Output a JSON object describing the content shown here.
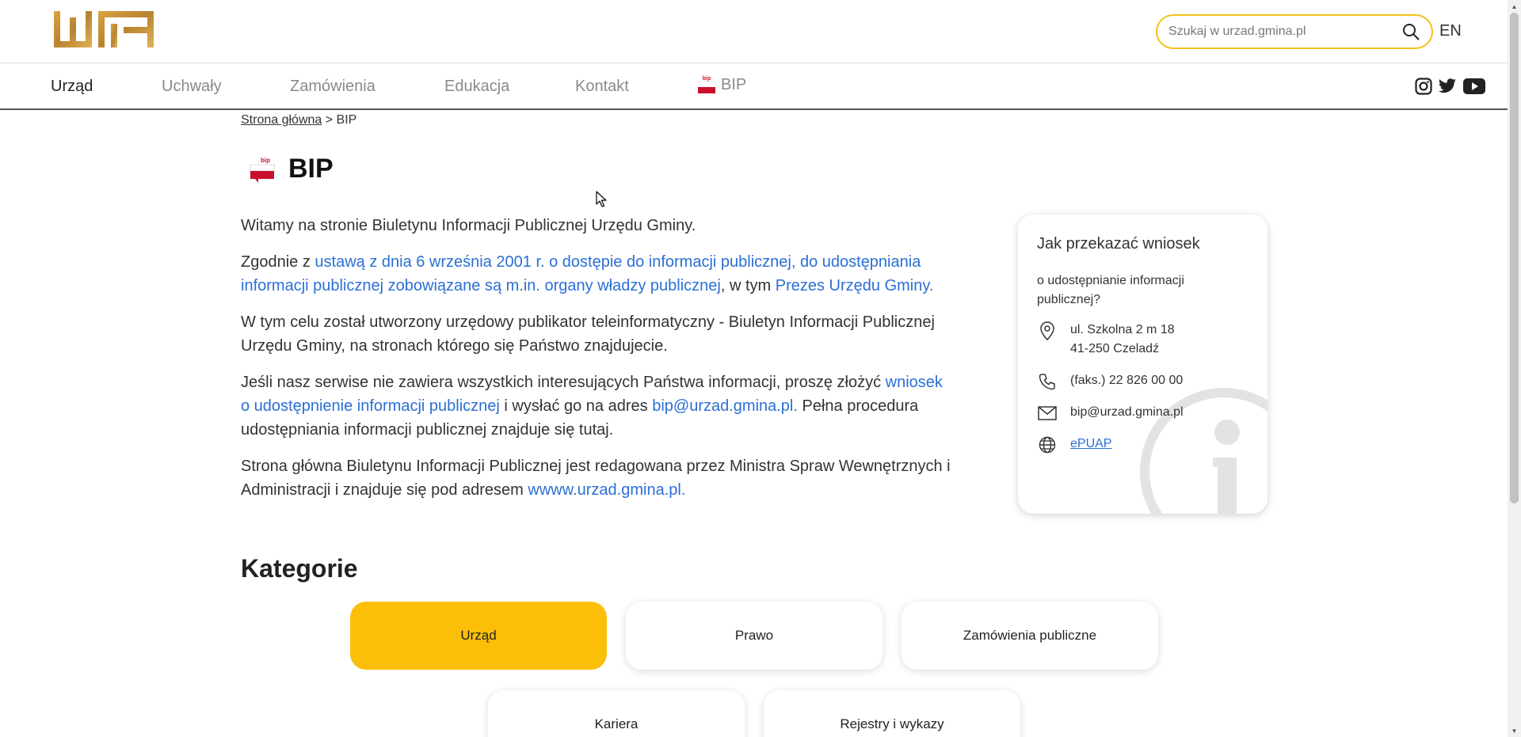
{
  "header": {
    "logo_text": "WA",
    "search": {
      "placeholder": "Szukaj w urzad.gmina.pl",
      "value": ""
    },
    "lang": "EN"
  },
  "nav": {
    "items": [
      {
        "label": "Urząd",
        "active": true
      },
      {
        "label": "Uchwały",
        "active": false
      },
      {
        "label": "Zamówienia",
        "active": false
      },
      {
        "label": "Edukacja",
        "active": false
      },
      {
        "label": "Kontakt",
        "active": false
      },
      {
        "label": "BIP",
        "active": false,
        "icon": "bip-flag-icon"
      }
    ],
    "social": [
      "instagram-icon",
      "twitter-icon",
      "youtube-icon"
    ]
  },
  "breadcrumb": {
    "home": "Strona główna",
    "separator": ">",
    "current": "BIP"
  },
  "page": {
    "title": "BIP",
    "intro": {
      "p1": "Witamy na stronie Biuletynu Informacji Publicznej Urzędu Gminy.",
      "p2_pre": "Zgodnie z ",
      "p2_link1": "ustawą z dnia 6 września 2001 r. o dostępie do informacji publicznej, do udostępniania informacji publicznej zobowiązane są m.in. organy władzy publicznej",
      "p2_mid": ", w tym ",
      "p2_link2": "Prezes Urzędu Gminy.",
      "p3": "W tym celu został utworzony urzędowy publikator teleinformatyczny - Biuletyn Informacji Publicznej Urzędu Gminy, na stronach którego się Państwo znajdujecie.",
      "p4_pre": "Jeśli nasz serwise nie zawiera wszystkich interesujących Państwa informacji, proszę złożyć ",
      "p4_link1": "wniosek o udostępnienie informacji publicznej",
      "p4_mid": " i wysłać go na adres ",
      "p4_link2": "bip@urzad.gmina.pl.",
      "p4_post": " Pełna procedura udostępniania informacji publicznej znajduje się tutaj.",
      "p5_pre": "Strona główna Biuletynu Informacji Publicznej jest redagowana przez Ministra Spraw Wewnętrznych i Administracji i znajduje się pod adresem ",
      "p5_link": "wwww.urzad.gmina.pl."
    }
  },
  "info_card": {
    "title": "Jak przekazać wniosek",
    "subtitle": "o udostępnianie informacji publicznej?",
    "address_line1": "ul. Szkolna 2 m 18",
    "address_line2": "41-250 Czeladź",
    "fax": "(faks.) 22 826 00 00",
    "email": "bip@urzad.gmina.pl",
    "epuap": "ePUAP"
  },
  "categories": {
    "title": "Kategorie",
    "items": [
      {
        "label": "Urząd",
        "active": true
      },
      {
        "label": "Prawo",
        "active": false
      },
      {
        "label": "Zamówienia publiczne",
        "active": false
      },
      {
        "label": "Kariera",
        "active": false
      },
      {
        "label": "Rejestry i wykazy",
        "active": false
      }
    ]
  },
  "colors": {
    "accent": "#fbbf0a",
    "search_border": "#f2c21b",
    "link": "#2b6fd6",
    "bip_red": "#c8102e"
  }
}
